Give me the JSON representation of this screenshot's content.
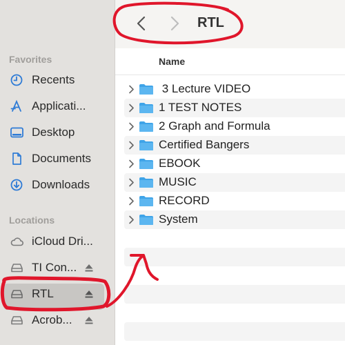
{
  "window": {
    "title": "RTL"
  },
  "sidebar": {
    "favorites_title": "Favorites",
    "favorites": [
      {
        "label": "Recents",
        "icon": "clock-icon"
      },
      {
        "label": "Applicati...",
        "icon": "applications-icon"
      },
      {
        "label": "Desktop",
        "icon": "desktop-icon"
      },
      {
        "label": "Documents",
        "icon": "document-icon"
      },
      {
        "label": "Downloads",
        "icon": "download-icon"
      }
    ],
    "locations_title": "Locations",
    "locations": [
      {
        "label": "iCloud Dri...",
        "icon": "cloud-icon"
      },
      {
        "label": "TI Con...",
        "icon": "drive-icon",
        "eject": true
      },
      {
        "label": "RTL",
        "icon": "drive-icon",
        "eject": true,
        "selected": true
      },
      {
        "label": "Acrob...",
        "icon": "drive-icon",
        "eject": true
      }
    ]
  },
  "list": {
    "column_name": "Name",
    "items": [
      {
        "label": " 3 Lecture VIDEO"
      },
      {
        "label": "1 TEST NOTES"
      },
      {
        "label": "2 Graph and Formula"
      },
      {
        "label": "Certified Bangers"
      },
      {
        "label": "EBOOK"
      },
      {
        "label": "MUSIC"
      },
      {
        "label": "RECORD"
      },
      {
        "label": "System"
      }
    ]
  },
  "colors": {
    "accent": "#2e7bd6",
    "annotation": "#e0162b",
    "folder": "#3fa4e8"
  }
}
